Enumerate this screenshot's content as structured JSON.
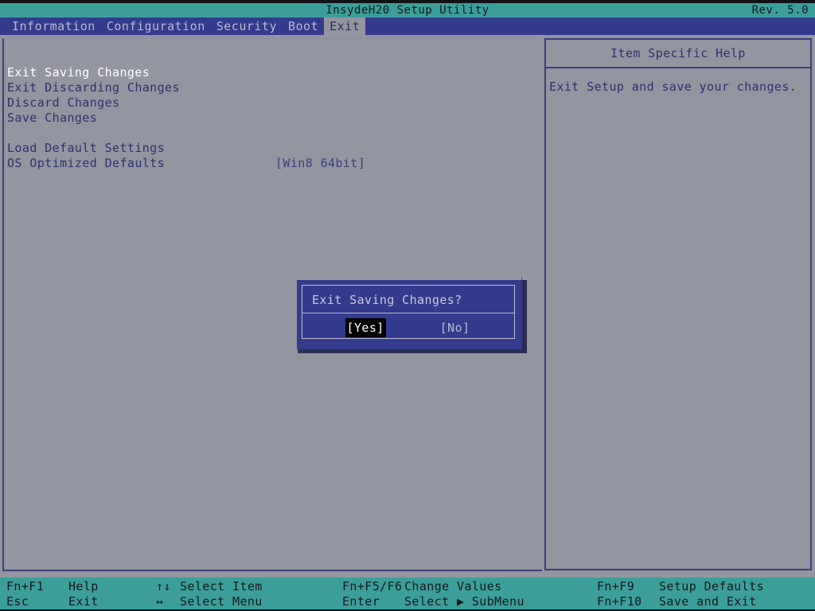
{
  "titlebar": {
    "title": "InsydeH20 Setup Utility",
    "revision": "Rev. 5.0"
  },
  "menubar": {
    "tabs": [
      {
        "label": "Information",
        "active": false
      },
      {
        "label": "Configuration",
        "active": false
      },
      {
        "label": "Security",
        "active": false
      },
      {
        "label": "Boot",
        "active": false
      },
      {
        "label": "Exit",
        "active": true
      }
    ]
  },
  "main": {
    "options": [
      {
        "label": "Exit Saving Changes",
        "value": "",
        "selected": true
      },
      {
        "label": "Exit Discarding Changes",
        "value": "",
        "selected": false
      },
      {
        "label": "Discard Changes",
        "value": "",
        "selected": false
      },
      {
        "label": "Save Changes",
        "value": "",
        "selected": false
      },
      {
        "label": "",
        "value": "",
        "selected": false
      },
      {
        "label": "Load Default Settings",
        "value": "",
        "selected": false
      },
      {
        "label": "OS Optimized Defaults",
        "value": "[Win8 64bit]",
        "selected": false
      }
    ]
  },
  "help": {
    "title": "Item Specific Help",
    "body": "Exit Setup and save your changes."
  },
  "dialog": {
    "message": "Exit Saving Changes?",
    "buttons": [
      {
        "label": "[Yes]",
        "selected": true
      },
      {
        "label": "[No]",
        "selected": false
      }
    ]
  },
  "bottombar": {
    "columns": [
      {
        "lines": [
          {
            "key": "Fn+F1",
            "action": "Help"
          },
          {
            "key": "Esc",
            "action": "Exit"
          }
        ]
      },
      {
        "lines": [
          {
            "key": "↑↓",
            "action": "Select Item"
          },
          {
            "key": "↔",
            "action": "Select Menu"
          }
        ]
      },
      {
        "lines": [
          {
            "key": "Fn+F5/F6",
            "action": "Change Values"
          },
          {
            "key": "Enter",
            "action": "Select ▶ SubMenu"
          }
        ]
      },
      {
        "lines": [
          {
            "key": "Fn+F9",
            "action": "Setup Defaults"
          },
          {
            "key": "Fn+F10",
            "action": "Save and Exit"
          }
        ]
      }
    ]
  },
  "colors": {
    "background": "#9395a0",
    "teal": "#3c9e9b",
    "menu_blue": "#343a8c",
    "text_blue": "#2d3270",
    "selected_white": "#ffffff",
    "black": "#000000"
  }
}
